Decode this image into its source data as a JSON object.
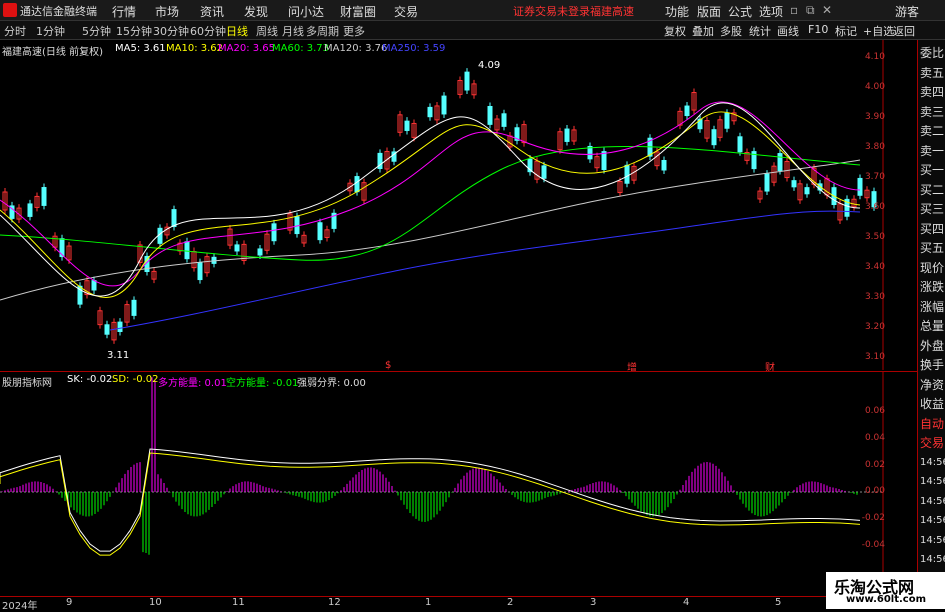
{
  "titlebar": {
    "app": "通达信金融终端",
    "menus": [
      "行情",
      "市场",
      "资讯",
      "发现",
      "问小达",
      "财富圈",
      "交易"
    ],
    "alert": "证券交易未登录",
    "stock_name": "福建高速",
    "right_menus": [
      "功能",
      "版面",
      "公式",
      "选项"
    ],
    "guest": "游客"
  },
  "toolbar": {
    "periods": [
      "分时",
      "1分钟",
      "5分钟",
      "15分钟",
      "30分钟",
      "60分钟",
      "日线",
      "周线",
      "月线",
      "多周期",
      "更多"
    ],
    "active": "日线",
    "actions": [
      "复权",
      "叠加",
      "多股",
      "统计",
      "画线",
      "F10",
      "标记",
      "+自选",
      "返回"
    ]
  },
  "main_legend": {
    "name": "福建高速(日线 前复权)",
    "ma5": "MA5: 3.61",
    "ma10": "MA10: 3.62",
    "ma20": "MA20: 3.65",
    "ma60": "MA60: 3.73",
    "ma120": "MA120: 3.76",
    "ma250": "MA250: 3.59"
  },
  "main_axis": {
    "labels": [
      "4.10",
      "4.00",
      "3.90",
      "3.80",
      "3.70",
      "3.60",
      "3.50",
      "3.40",
      "3.30",
      "3.20",
      "3.10"
    ],
    "high_mark": "4.09",
    "low_mark": "3.11",
    "markers": [
      "$",
      "增",
      "财"
    ]
  },
  "ind_legend": {
    "name": "股朋指标网",
    "sk": "SK: -0.02",
    "sd": "SD: -0.02",
    "long": "多方能量: 0.01",
    "short": "空方能量: -0.01",
    "bound": "强弱分界: 0.00"
  },
  "ind_axis": {
    "labels": [
      "0.06",
      "0.04",
      "0.02",
      "0.00",
      "-0.02",
      "-0.04"
    ]
  },
  "sidebar": {
    "items": [
      "委比",
      "卖五",
      "卖四",
      "卖三",
      "卖二",
      "卖一",
      "买一",
      "买二",
      "买三",
      "买四",
      "买五",
      "现价",
      "涨跌",
      "涨幅",
      "总量",
      "外盘",
      "换手",
      "净资",
      "收益",
      "自动",
      "交易",
      "14:56",
      "14:56",
      "14:56",
      "14:56",
      "14:56",
      "14:56",
      "14:56"
    ]
  },
  "xaxis": {
    "labels": [
      "2024年",
      "9",
      "10",
      "11",
      "12",
      "1",
      "2",
      "3",
      "4",
      "5"
    ]
  },
  "watermark": {
    "title": "乐淘公式网",
    "url": "www.60lt.com"
  },
  "colors": {
    "up": "#ff3333",
    "down": "#55ffff",
    "ma5": "#ffffff",
    "ma10": "#ffff00",
    "ma20": "#ff00ff",
    "ma60": "#00ff00",
    "ma120": "#cccccc",
    "ma250": "#3333ff"
  }
}
